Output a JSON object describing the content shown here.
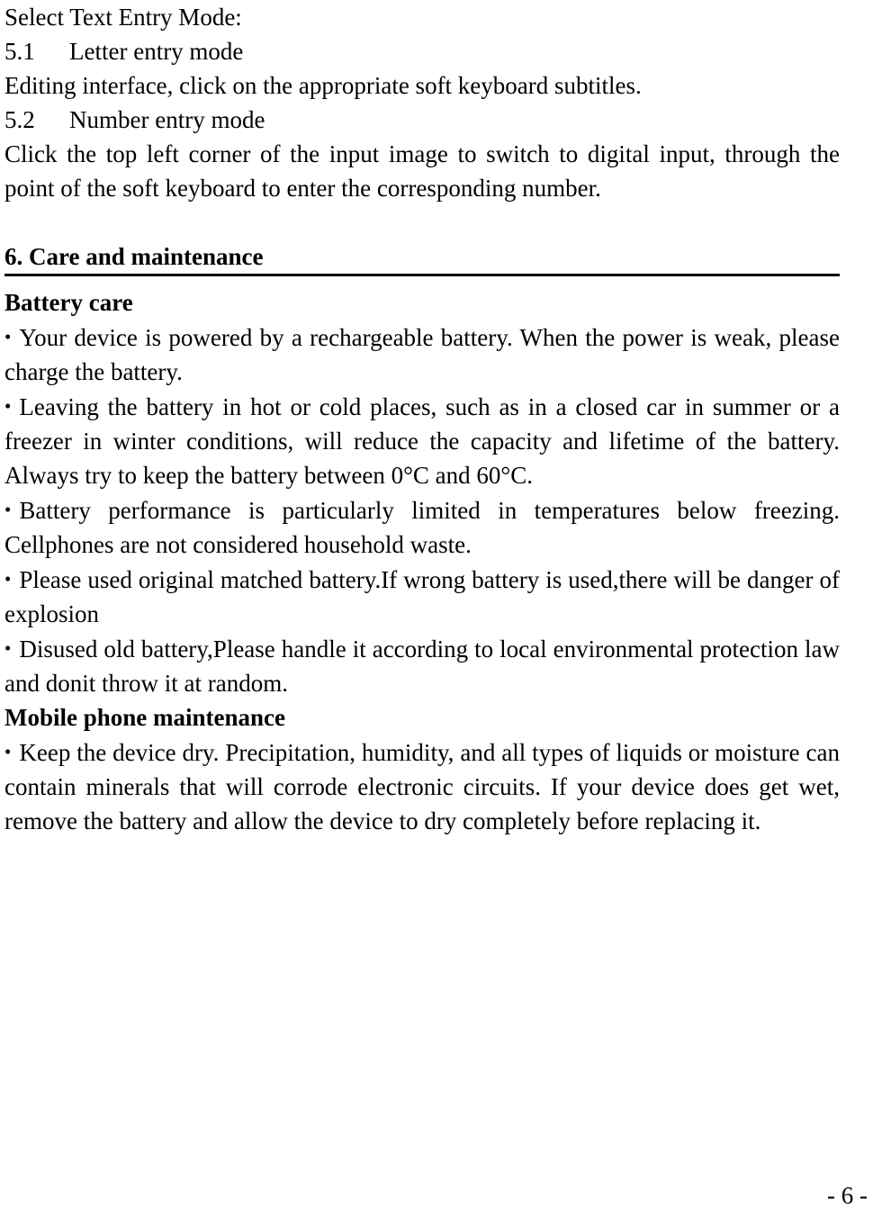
{
  "document": {
    "intro_line": "Select Text Entry Mode:",
    "subsections": [
      {
        "number": "5.1",
        "title": "Letter entry mode"
      },
      {
        "number": "5.2",
        "title": "Number entry mode"
      }
    ],
    "paragraphs": {
      "letter_entry_body": "Editing interface, click on the appropriate soft keyboard subtitles.",
      "number_entry_body": "Click the top left corner of the input image to switch to digital input, through the point of the soft keyboard to enter the corresponding number."
    },
    "section": {
      "heading": "6. Care and maintenance"
    },
    "battery": {
      "subheading": "Battery care",
      "bullets": [
        "Your device is powered by a rechargeable battery. When the power is weak, please charge the battery.",
        "Leaving the battery in hot or cold places, such as in a closed car in summer or a freezer in winter conditions, will reduce the capacity and lifetime of the battery. Always try to keep the battery between 0°C and 60°C.",
        "Battery performance is particularly limited in temperatures below freezing. Cellphones are not considered household waste.",
        "Please used original matched battery.If wrong battery is used,there will be danger of explosion",
        "Disused old battery,Please handle it according to local environmental protection law and donit throw it at random."
      ]
    },
    "maintenance": {
      "subheading": "Mobile phone maintenance",
      "bullets": [
        "Keep the device dry. Precipitation, humidity, and all types of liquids or moisture can contain minerals that will corrode electronic circuits. If your device does get wet, remove the battery and allow the device to dry completely before replacing it."
      ]
    },
    "bullet_glyph": "•",
    "footer": {
      "page_number": "- 6 -"
    }
  }
}
